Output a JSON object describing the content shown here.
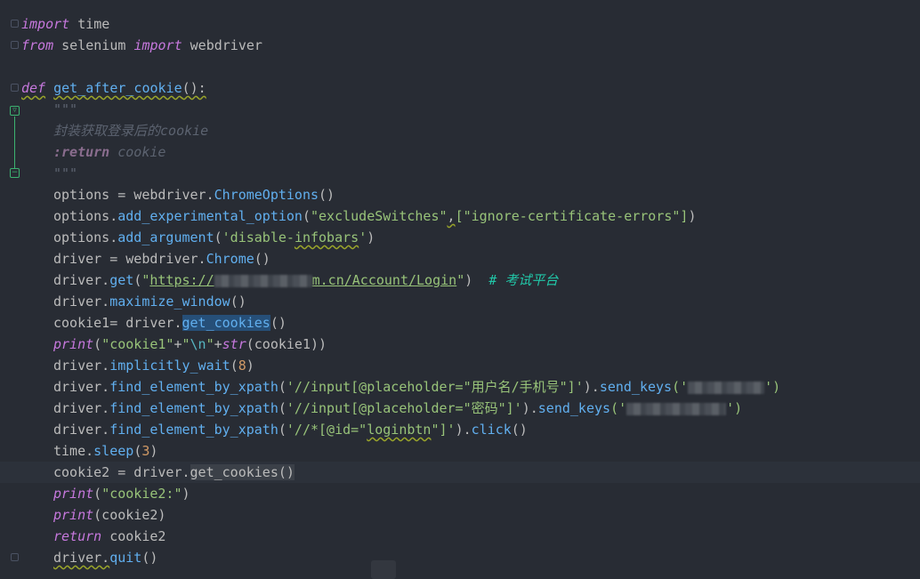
{
  "editor": {
    "lines": [
      {
        "t": "import time"
      },
      {
        "t": "from selenium import webdriver"
      },
      {
        "t": ""
      },
      {
        "t": "def get_after_cookie():"
      },
      {
        "t": "\"\"\""
      },
      {
        "t": "封装获取登录后的cookie"
      },
      {
        "t": ":return cookie"
      },
      {
        "t": "\"\"\""
      },
      {
        "t": "options = webdriver.ChromeOptions()"
      },
      {
        "t": "options.add_experimental_option(\"excludeSwitches\", [\"ignore-certificate-errors\"])"
      },
      {
        "t": "options.add_argument('disable-infobars')"
      },
      {
        "t": "driver = webdriver.Chrome()"
      },
      {
        "t": "driver.get(\"https://▒▒▒▒m.cn/Account/Login\")  # 考试平台"
      },
      {
        "t": "driver.maximize_window()"
      },
      {
        "t": "cookie1= driver.get_cookies()"
      },
      {
        "t": "print(\"cookie1\"+\"\\n\"+str(cookie1))"
      },
      {
        "t": "driver.implicitly_wait(8)"
      },
      {
        "t": "driver.find_element_by_xpath('//input[@placeholder=\"用户名/手机号\"]').send_keys('▒▒▒')"
      },
      {
        "t": "driver.find_element_by_xpath('//input[@placeholder=\"密码\"]').send_keys('▒▒▒')"
      },
      {
        "t": "driver.find_element_by_xpath('//*[@id=\"loginbtn\"]').click()"
      },
      {
        "t": "time.sleep(3)"
      },
      {
        "t": "cookie2 = driver.get_cookies()"
      },
      {
        "t": "print(\"cookie2:\")"
      },
      {
        "t": "print(cookie2)"
      },
      {
        "t": "return cookie2"
      },
      {
        "t": "driver.quit()"
      }
    ]
  },
  "tokens": {
    "import": "import",
    "time": " time",
    "from": "from",
    "selenium": " selenium ",
    "webdriver": " webdriver",
    "def": "def",
    "func_name": "get_after_cookie",
    "func_sig": "():",
    "doc_quotes": "\"\"\"",
    "doc_text": "封装获取登录后的",
    "doc_cookie": "cookie",
    "doc_return": ":return",
    "doc_return_val": " cookie",
    "options_eq": "options = webdriver.",
    "ChromeOptions": "ChromeOptions",
    "paren_pair": "()",
    "options_dot": "options.",
    "add_experimental_option": "add_experimental_option",
    "open_paren": "(",
    "close_paren": ")",
    "excludeSwitches": "\"excludeSwitches\"",
    "comma": ",",
    "ignore_cert": "[\"ignore-certificate-errors\"]",
    "add_argument": "add_argument",
    "disable_q1": "'disable-",
    "infobars": "infobars",
    "disable_q2": "'",
    "driver_eq": "driver = webdriver.",
    "Chrome": "Chrome",
    "driver_dot": "driver.",
    "get": "get",
    "url_q": "\"",
    "url_prefix": "https://",
    "url_suffix": "m.cn/Account/Login",
    "comment": "# 考试平台",
    "maximize_window": "maximize_window",
    "cookie1_eq": "cookie1",
    "cookie1_op": "= driver.",
    "get_cookies": "get_cookies",
    "print": "print",
    "cookie1_str": "\"cookie1\"",
    "plus": "+",
    "nl_q1": "\"",
    "nl_esc": "\\n",
    "nl_q2": "\"",
    "str_fn": "str",
    "cookie1_arg": "(cookie1))",
    "implicitly_wait": "implicitly_wait",
    "eight": "8",
    "find_element_by_xpath": "find_element_by_xpath",
    "xpath_user_a": "'//input[@placeholder=\"用户名/手机号\"]'",
    "send_keys": "send_keys",
    "q_open": "('",
    "q_close": "')",
    "xpath_pwd_a": "'//input[@placeholder=\"密码\"]'",
    "xpath_btn_a": "'//*[@id=\"",
    "loginbtn": "loginbtn",
    "xpath_btn_b": "\"]'",
    "click": "click",
    "time_dot": "time.",
    "sleep": "sleep",
    "three": "3",
    "cookie2_eq": "cookie2 = driver.",
    "cookie2_str": "\"cookie2:\"",
    "cookie2_arg": "(cookie2)",
    "return": "return",
    "cookie2": " cookie2",
    "quit": "quit"
  },
  "colors": {
    "background": "#282c34",
    "keyword": "#c678dd",
    "function": "#61afef",
    "string": "#98c379",
    "number": "#d19a66",
    "comment": "#21c7a8"
  }
}
